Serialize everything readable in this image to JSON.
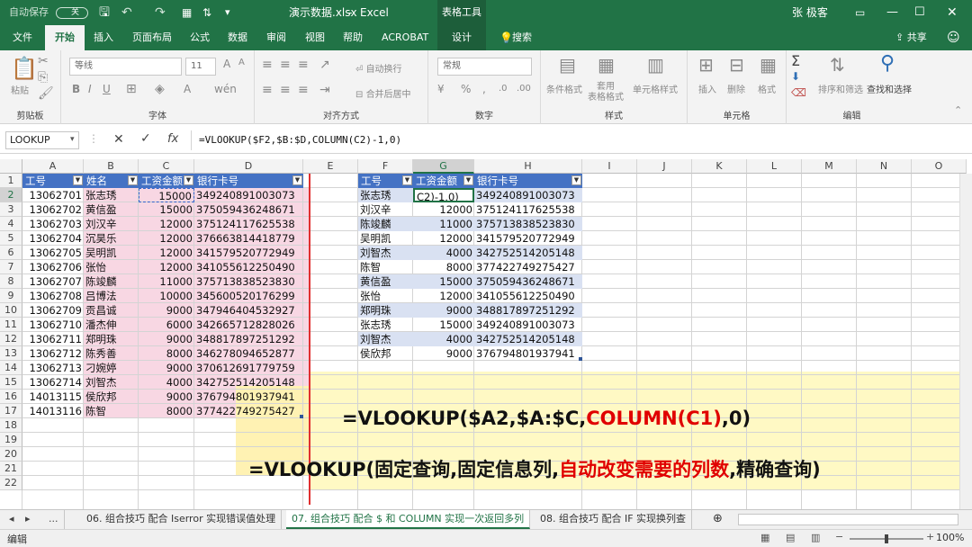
{
  "titlebar": {
    "autosave": "自动保存",
    "autosave_state": "关",
    "filename": "演示数据.xlsx",
    "app": "Excel",
    "tools": "表格工具",
    "user": "张 极客"
  },
  "tabs": [
    "文件",
    "开始",
    "插入",
    "页面布局",
    "公式",
    "数据",
    "审阅",
    "视图",
    "帮助",
    "ACROBAT",
    "设计"
  ],
  "search": "搜索",
  "share": "共享",
  "ribbon": {
    "groups": [
      "剪贴板",
      "字体",
      "对齐方式",
      "数字",
      "样式",
      "单元格",
      "编辑"
    ],
    "paste": "粘贴",
    "font_name": "等线",
    "font_size": "11",
    "wrap": "自动换行",
    "merge": "合并后居中",
    "number_format": "常规",
    "cond_format": "条件格式",
    "table_format": "套用\n表格格式",
    "cell_style": "单元格样式",
    "insert": "插入",
    "delete": "删除",
    "format": "格式",
    "sort": "排序和筛选",
    "find": "查找和选择"
  },
  "formula_bar": {
    "namebox": "LOOKUP",
    "formula": "=VLOOKUP($F2,$B:$D,COLUMN(C2)-1,0)"
  },
  "columns": [
    "A",
    "B",
    "C",
    "D",
    "E",
    "F",
    "G",
    "H",
    "I",
    "J",
    "K",
    "L",
    "M",
    "N",
    "O"
  ],
  "rows": [
    "1",
    "2",
    "3",
    "4",
    "5",
    "6",
    "7",
    "8",
    "9",
    "10",
    "11",
    "12",
    "13",
    "14",
    "15",
    "16",
    "17",
    "18",
    "19",
    "20",
    "21",
    "22"
  ],
  "table1": {
    "headers": [
      "工号",
      "姓名",
      "工资金额",
      "银行卡号"
    ],
    "rows": [
      [
        "13062701",
        "张志琇",
        "15000",
        "349240891003073"
      ],
      [
        "13062702",
        "黄信盈",
        "15000",
        "375059436248671"
      ],
      [
        "13062703",
        "刘汉辛",
        "12000",
        "375124117625538"
      ],
      [
        "13062704",
        "沉昊乐",
        "12000",
        "376663814418779"
      ],
      [
        "13062705",
        "吴明凯",
        "12000",
        "341579520772949"
      ],
      [
        "13062706",
        "张怡",
        "12000",
        "341055612250490"
      ],
      [
        "13062707",
        "陈竣麟",
        "11000",
        "375713838523830"
      ],
      [
        "13062708",
        "吕博法",
        "10000",
        "345600520176299"
      ],
      [
        "13062709",
        "贡昌诚",
        "9000",
        "347946404532927"
      ],
      [
        "13062710",
        "潘杰伸",
        "6000",
        "342665712828026"
      ],
      [
        "13062711",
        "郑明珠",
        "9000",
        "348817897251292"
      ],
      [
        "13062712",
        "陈秀善",
        "8000",
        "346278094652877"
      ],
      [
        "13062713",
        "刁婉婷",
        "9000",
        "370612691779759"
      ],
      [
        "13062714",
        "刘智杰",
        "4000",
        "342752514205148"
      ],
      [
        "14013115",
        "侯欣邦",
        "9000",
        "376794801937941"
      ],
      [
        "14013116",
        "陈智",
        "8000",
        "377422749275427"
      ]
    ]
  },
  "table2": {
    "headers": [
      "工号",
      "工资金额",
      "银行卡号"
    ],
    "rows": [
      [
        "张志琇",
        "C2)-1,0)",
        "349240891003073"
      ],
      [
        "刘汉辛",
        "12000",
        "375124117625538"
      ],
      [
        "陈竣麟",
        "11000",
        "375713838523830"
      ],
      [
        "吴明凯",
        "12000",
        "341579520772949"
      ],
      [
        "刘智杰",
        "4000",
        "342752514205148"
      ],
      [
        "陈智",
        "8000",
        "377422749275427"
      ],
      [
        "黄信盈",
        "15000",
        "375059436248671"
      ],
      [
        "张怡",
        "12000",
        "341055612250490"
      ],
      [
        "郑明珠",
        "9000",
        "348817897251292"
      ],
      [
        "张志琇",
        "15000",
        "349240891003073"
      ],
      [
        "刘智杰",
        "4000",
        "342752514205148"
      ],
      [
        "侯欣邦",
        "9000",
        "376794801937941"
      ]
    ]
  },
  "caption": {
    "line1_a": "=VLOOKUP($A2,$A:$C,",
    "line1_b": "COLUMN(C1)",
    "line1_c": ",0)",
    "line2_a": "=VLOOKUP(固定查询,固定信息列,",
    "line2_b": "自动改变需要的列数",
    "line2_c": ",精确查询)"
  },
  "sheet_tabs": [
    "06. 组合技巧 配合 Iserror 实现错误值处理",
    "07. 组合技巧 配合 $ 和 COLUMN 实现一次返回多列",
    "08. 组合技巧 配合 IF 实现换列查"
  ],
  "status": {
    "mode": "编辑",
    "zoom": "100%"
  },
  "colors": {
    "excel_green": "#217346",
    "table_header": "#4472c4",
    "highlight_yellow": "#fff9c4",
    "highlight_pink": "#f8d7e3",
    "red": "#e00000"
  }
}
